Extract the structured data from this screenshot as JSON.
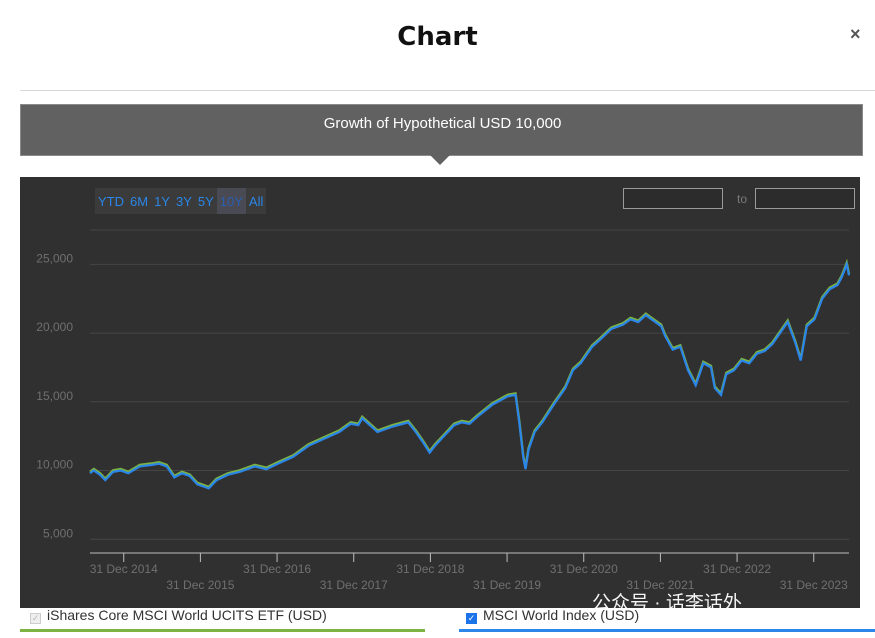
{
  "header": {
    "title": "Chart",
    "close_label": "×"
  },
  "banner": {
    "text": "Growth of Hypothetical USD 10,000"
  },
  "range_buttons": [
    "YTD",
    "6M",
    "1Y",
    "3Y",
    "5Y",
    "10Y",
    "All"
  ],
  "active_range": "10Y",
  "date_range": {
    "to_label": "to"
  },
  "legend": {
    "fund": "iShares Core MSCI World UCITS ETF (USD)",
    "index": "MSCI World Index (USD)"
  },
  "watermark": "公众号 · 话李话外",
  "colors": {
    "fund": "#7cb342",
    "index": "#2a86e8",
    "background": "#303030"
  },
  "chart_data": {
    "type": "line",
    "y_ticks": [
      "5,000",
      "10,000",
      "15,000",
      "20,000",
      "25,000"
    ],
    "y_tick_values": [
      5000,
      10000,
      15000,
      20000,
      25000
    ],
    "ylim": [
      4000,
      27500
    ],
    "x_ticks_upper": [
      "31 Dec 2014",
      "31 Dec 2016",
      "31 Dec 2018",
      "31 Dec 2020",
      "31 Dec 2022"
    ],
    "x_ticks_lower": [
      "31 Dec 2015",
      "31 Dec 2017",
      "31 Dec 2019",
      "31 Dec 2021",
      "31 Dec 2023"
    ],
    "x_tick_years": [
      2014.99,
      2015.99,
      2016.99,
      2017.99,
      2018.99,
      2019.99,
      2020.99,
      2021.99,
      2022.99,
      2023.99
    ],
    "xlim": [
      2014.55,
      2024.45
    ],
    "series": [
      {
        "name": "MSCI World Index (USD)",
        "x": [
          2014.55,
          2014.6,
          2014.68,
          2014.75,
          2014.85,
          2014.95,
          2015.05,
          2015.2,
          2015.35,
          2015.45,
          2015.55,
          2015.65,
          2015.75,
          2015.85,
          2015.95,
          2016.1,
          2016.2,
          2016.35,
          2016.5,
          2016.7,
          2016.85,
          2017.0,
          2017.2,
          2017.4,
          2017.6,
          2017.8,
          2017.95,
          2018.05,
          2018.1,
          2018.3,
          2018.5,
          2018.7,
          2018.8,
          2018.9,
          2018.98,
          2019.05,
          2019.2,
          2019.3,
          2019.4,
          2019.5,
          2019.6,
          2019.8,
          2020.0,
          2020.1,
          2020.15,
          2020.2,
          2020.23,
          2020.27,
          2020.35,
          2020.45,
          2020.6,
          2020.75,
          2020.85,
          2020.95,
          2021.1,
          2021.2,
          2021.35,
          2021.5,
          2021.6,
          2021.7,
          2021.8,
          2021.9,
          2022.0,
          2022.05,
          2022.15,
          2022.25,
          2022.35,
          2022.45,
          2022.55,
          2022.65,
          2022.7,
          2022.78,
          2022.85,
          2022.95,
          2023.05,
          2023.15,
          2023.25,
          2023.35,
          2023.45,
          2023.55,
          2023.65,
          2023.75,
          2023.82,
          2023.9,
          2024.0,
          2024.1,
          2024.2,
          2024.3,
          2024.35,
          2024.38,
          2024.42,
          2024.45
        ],
        "values": [
          9800,
          10000,
          9700,
          9300,
          9900,
          10000,
          9800,
          10300,
          10400,
          10500,
          10300,
          9500,
          9800,
          9600,
          9000,
          8700,
          9300,
          9700,
          9900,
          10300,
          10100,
          10500,
          11000,
          11800,
          12300,
          12800,
          13400,
          13300,
          13800,
          12800,
          13200,
          13500,
          12800,
          12000,
          11300,
          11800,
          12700,
          13300,
          13500,
          13400,
          13900,
          14800,
          15400,
          15500,
          13500,
          11000,
          10100,
          11500,
          12800,
          13500,
          14800,
          16000,
          17300,
          17800,
          19000,
          19500,
          20300,
          20600,
          21000,
          20800,
          21300,
          20900,
          20500,
          19800,
          18800,
          19000,
          17300,
          16200,
          17800,
          17500,
          16000,
          15500,
          17000,
          17300,
          18000,
          17800,
          18500,
          18700,
          19200,
          20000,
          20800,
          19300,
          18000,
          20500,
          21000,
          22500,
          23200,
          23500,
          24000,
          24400,
          25000,
          24200
        ]
      }
    ]
  }
}
